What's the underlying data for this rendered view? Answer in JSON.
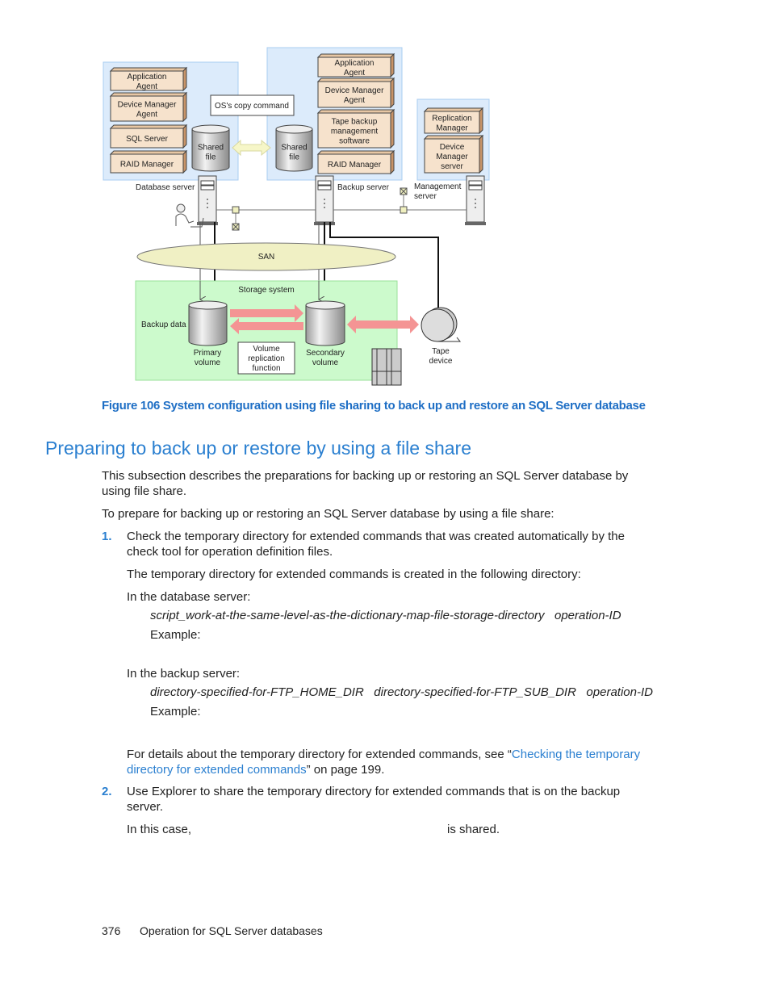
{
  "figure": {
    "database_server": {
      "label": "Database server",
      "components": [
        "Application Agent",
        "Device Manager Agent",
        "SQL Server",
        "RAID Manager"
      ],
      "shared_file": "Shared file"
    },
    "copy_command": "OS's copy command",
    "backup_server": {
      "label": "Backup server",
      "components": [
        "Application Agent",
        "Device Manager Agent",
        "Tape backup management software",
        "RAID Manager"
      ],
      "shared_file": "Shared file"
    },
    "management_server": {
      "label": "Management server",
      "components": [
        "Replication Manager",
        "Device Manager server"
      ]
    },
    "san": "SAN",
    "storage_system": "Storage system",
    "backup_data": "Backup data",
    "primary_volume": "Primary volume",
    "secondary_volume": "Secondary volume",
    "volume_replication": "Volume replication function",
    "tape_device": "Tape device",
    "colors": {
      "panel": "#dcebfb",
      "component": "#f6e2cc",
      "storage": "#ccfacc",
      "san": "#f0f0c4",
      "arrow": "#f49494"
    }
  },
  "caption": "Figure 106 System configuration using file sharing to back up and restore an SQL Server database",
  "section": {
    "title": "Preparing to back up or restore by using a file share",
    "intro1": "This subsection describes the preparations for backing up or restoring an SQL Server database by using file share.",
    "intro2": "To prepare for backing up or restoring an SQL Server database by using a file share:",
    "steps": [
      {
        "num": "1.",
        "text": "Check the temporary directory for extended commands that was created automatically by the check tool for operation definition files.",
        "p2": "The temporary directory for extended commands is created in the following directory:",
        "db_label": "In the database server:",
        "db_path": "script_work-at-the-same-level-as-the-dictionary-map-file-storage-directory   operation-ID",
        "db_example": "Example:",
        "bk_label": "In the backup server:",
        "bk_path": "directory-specified-for-FTP_HOME_DIR   directory-specified-for-FTP_SUB_DIR   operation-ID",
        "bk_example": "Example:",
        "details_pre": "For details about the temporary directory for extended commands, see “",
        "details_link": "Checking the temporary directory for extended commands",
        "details_post": "” on page 199."
      },
      {
        "num": "2.",
        "text": "Use Explorer to share the temporary directory for extended commands that is on the backup server.",
        "case_pre": "In this case,",
        "case_post": "is shared."
      }
    ]
  },
  "footer": {
    "page": "376",
    "title": "Operation for SQL Server databases"
  }
}
